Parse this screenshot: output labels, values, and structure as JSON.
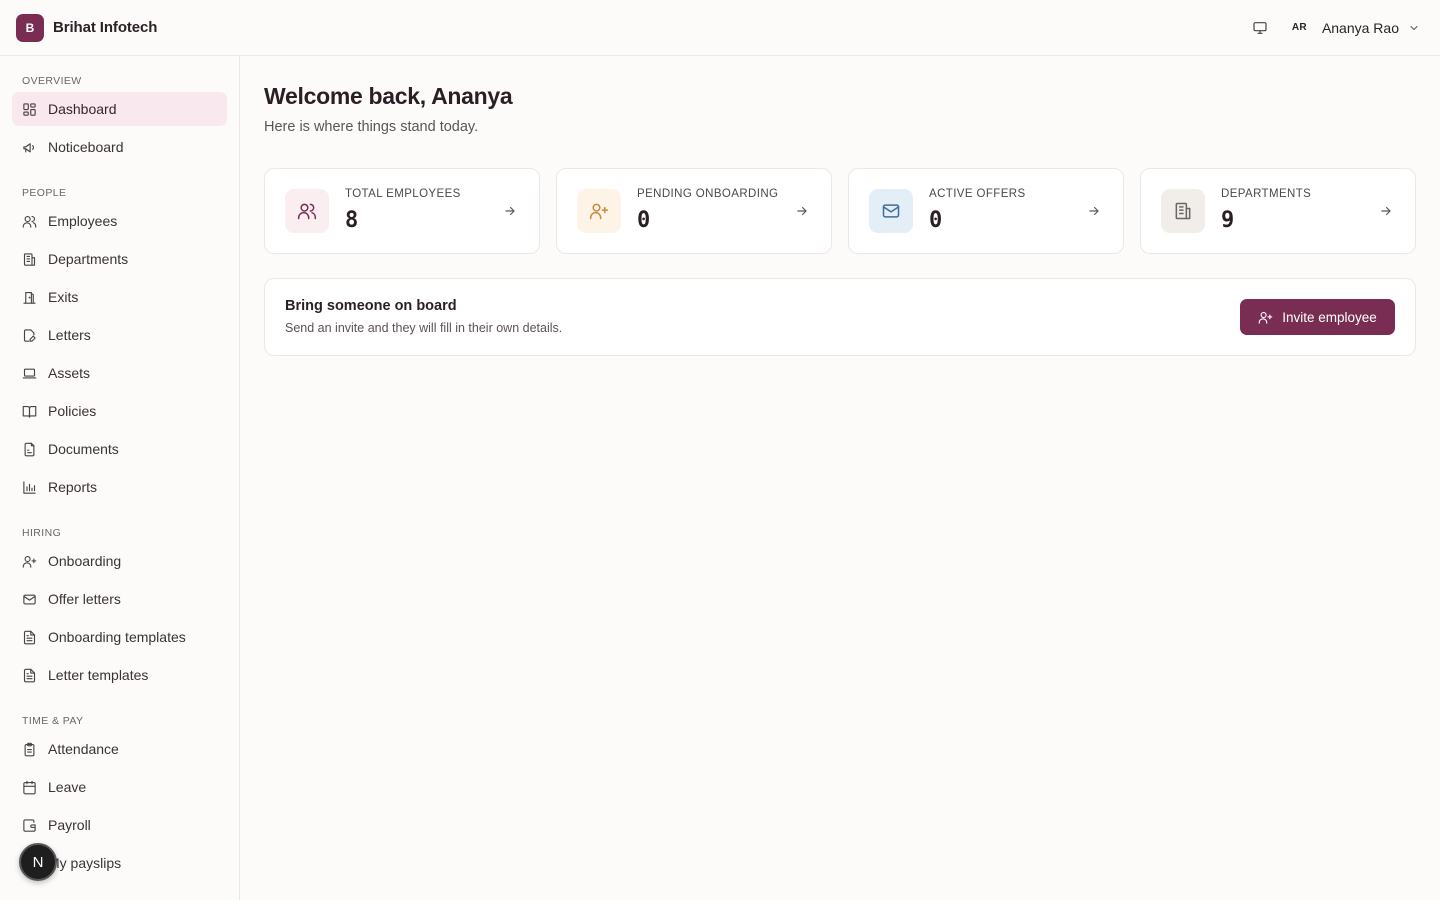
{
  "brand": {
    "logo_letter": "B",
    "name": "Brihat Infotech"
  },
  "topbar": {
    "user_initials": "AR",
    "user_name": "Ananya Rao"
  },
  "sidebar": {
    "sections": [
      {
        "label": "OVERVIEW",
        "items": [
          {
            "label": "Dashboard",
            "icon": "dashboard-icon",
            "active": true
          },
          {
            "label": "Noticeboard",
            "icon": "megaphone-icon"
          }
        ]
      },
      {
        "label": "PEOPLE",
        "items": [
          {
            "label": "Employees",
            "icon": "users-icon"
          },
          {
            "label": "Departments",
            "icon": "building-icon"
          },
          {
            "label": "Exits",
            "icon": "door-icon"
          },
          {
            "label": "Letters",
            "icon": "file-edit-icon"
          },
          {
            "label": "Assets",
            "icon": "laptop-icon"
          },
          {
            "label": "Policies",
            "icon": "book-icon"
          },
          {
            "label": "Documents",
            "icon": "files-icon"
          },
          {
            "label": "Reports",
            "icon": "bar-chart-icon"
          }
        ]
      },
      {
        "label": "HIRING",
        "items": [
          {
            "label": "Onboarding",
            "icon": "user-plus-icon"
          },
          {
            "label": "Offer letters",
            "icon": "mail-icon"
          },
          {
            "label": "Onboarding templates",
            "icon": "file-text-icon"
          },
          {
            "label": "Letter templates",
            "icon": "file-text-icon"
          }
        ]
      },
      {
        "label": "TIME & PAY",
        "items": [
          {
            "label": "Attendance",
            "icon": "clipboard-icon"
          },
          {
            "label": "Leave",
            "icon": "calendar-icon"
          },
          {
            "label": "Payroll",
            "icon": "wallet-icon"
          },
          {
            "label": "My payslips",
            "icon": "receipt-icon"
          }
        ]
      }
    ]
  },
  "fab": {
    "label": "N"
  },
  "main": {
    "welcome": "Welcome back, Ananya",
    "subtitle": "Here is where things stand today.",
    "stats": [
      {
        "label": "TOTAL EMPLOYEES",
        "value": "8",
        "icon": "users-icon",
        "icon_bg": "#fbeef1",
        "icon_color": "#7a2d53"
      },
      {
        "label": "PENDING ONBOARDING",
        "value": "0",
        "icon": "user-plus-icon",
        "icon_bg": "#fdf3e6",
        "icon_color": "#c98a3a"
      },
      {
        "label": "ACTIVE OFFERS",
        "value": "0",
        "icon": "mail-icon",
        "icon_bg": "#e4eef7",
        "icon_color": "#3f6e9a"
      },
      {
        "label": "DEPARTMENTS",
        "value": "9",
        "icon": "building-icon",
        "icon_bg": "#f1ede9",
        "icon_color": "#6d6468"
      }
    ],
    "invite": {
      "title": "Bring someone on board",
      "description": "Send an invite and they will fill in their own details.",
      "button_label": "Invite employee"
    }
  },
  "colors": {
    "accent": "#7a2d53",
    "active_bg": "#f9e9ee"
  }
}
